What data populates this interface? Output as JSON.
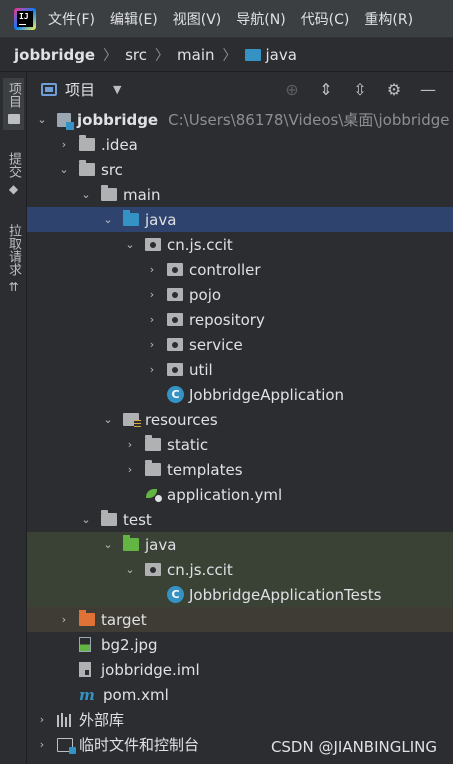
{
  "menubar": {
    "items": [
      "文件(F)",
      "编辑(E)",
      "视图(V)",
      "导航(N)",
      "代码(C)",
      "重构(R)"
    ]
  },
  "breadcrumb": [
    "jobbridge",
    "src",
    "main",
    "java"
  ],
  "toolstrip": {
    "tabs": [
      "项目",
      "提交",
      "拉取请求"
    ]
  },
  "panel": {
    "title": "项目"
  },
  "tree": {
    "root_name": "jobbridge",
    "root_path": "C:\\Users\\86178\\Videos\\桌面\\jobbridge",
    "idea": ".idea",
    "src": "src",
    "main": "main",
    "java_main": "java",
    "pkg_main": "cn.js.ccit",
    "controller": "controller",
    "pojo": "pojo",
    "repository": "repository",
    "service": "service",
    "util": "util",
    "app_class": "JobbridgeApplication",
    "resources": "resources",
    "static": "static",
    "templates": "templates",
    "app_yml": "application.yml",
    "test": "test",
    "java_test": "java",
    "pkg_test": "cn.js.ccit",
    "test_class": "JobbridgeApplicationTests",
    "target": "target",
    "bg2": "bg2.jpg",
    "iml": "jobbridge.iml",
    "pom": "pom.xml",
    "ext_libs": "外部库",
    "scratches": "临时文件和控制台"
  },
  "watermark": "CSDN @JIANBINGLING",
  "colors": {
    "selected_row": "#2e436e",
    "source_folder": "#3592c4",
    "test_folder": "#62b543",
    "excluded_folder": "#e07137"
  }
}
